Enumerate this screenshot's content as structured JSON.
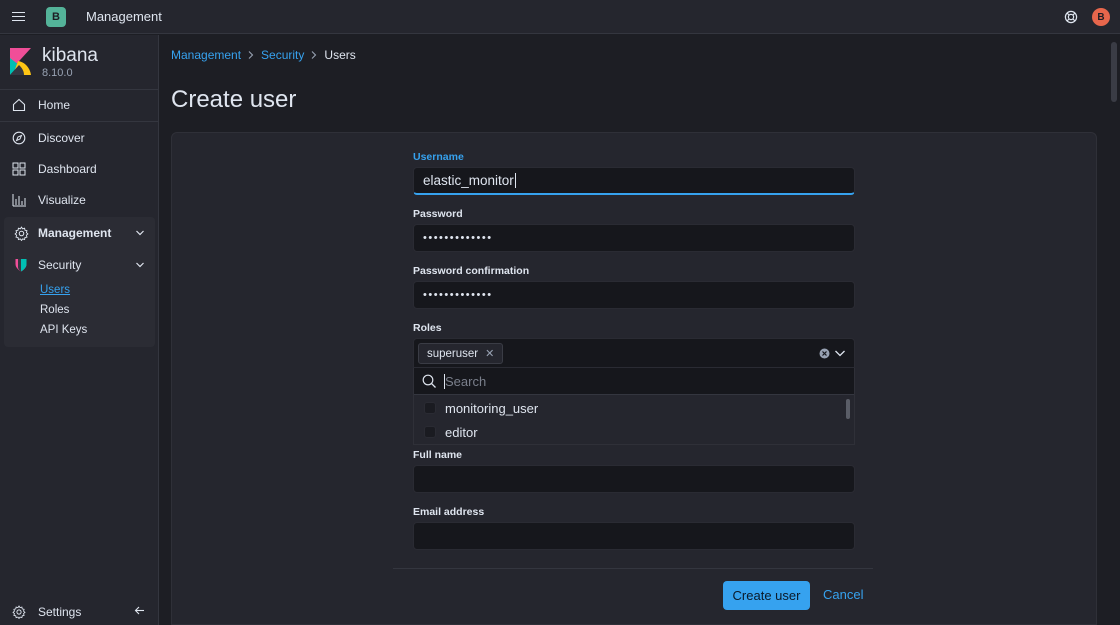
{
  "header": {
    "space_initial": "B",
    "title": "Management",
    "user_initial": "B"
  },
  "sidebar": {
    "brand": {
      "name": "kibana",
      "version": "8.10.0"
    },
    "items": [
      {
        "label": "Home",
        "icon": "home-icon"
      },
      {
        "label": "Discover",
        "icon": "compass-icon"
      },
      {
        "label": "Dashboard",
        "icon": "dashboard-icon"
      },
      {
        "label": "Visualize",
        "icon": "bar-chart-icon"
      }
    ],
    "management": {
      "label": "Management",
      "security": {
        "label": "Security",
        "subitems": [
          "Users",
          "Roles",
          "API Keys"
        ],
        "active": "Users"
      }
    },
    "settings_label": "Settings"
  },
  "breadcrumb": {
    "items": [
      "Management",
      "Security"
    ],
    "current": "Users"
  },
  "page": {
    "title": "Create user"
  },
  "form": {
    "username": {
      "label": "Username",
      "value": "elastic_monitor"
    },
    "password": {
      "label": "Password",
      "value": "•••••••••••••"
    },
    "password_confirmation": {
      "label": "Password confirmation",
      "value": "•••••••••••••"
    },
    "roles": {
      "label": "Roles",
      "selected": [
        "superuser"
      ],
      "search_placeholder": "Search",
      "options": [
        "monitoring_user",
        "editor"
      ]
    },
    "full_name": {
      "label": "Full name",
      "value": ""
    },
    "email": {
      "label": "Email address",
      "value": ""
    }
  },
  "actions": {
    "create_label": "Create user",
    "cancel_label": "Cancel"
  },
  "colors": {
    "accent": "#36a2ef",
    "background": "#1d1e24",
    "panel": "#25262e",
    "space_badge": "#54b399",
    "avatar": "#e7664c"
  }
}
